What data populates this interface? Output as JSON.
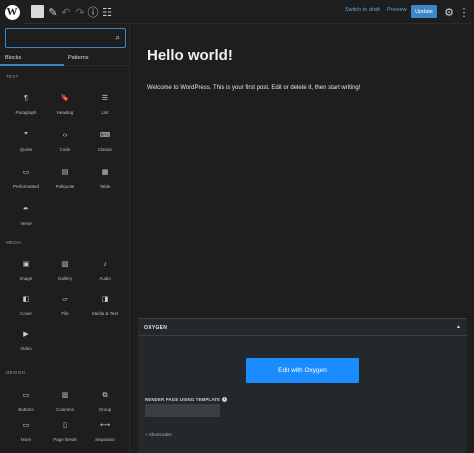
{
  "toolbar": {
    "logo_letter": "W",
    "switch_to_draft": "Switch to draft",
    "preview": "Preview",
    "update": "Update"
  },
  "sidebar": {
    "search_placeholder": "",
    "tabs": [
      "Blocks",
      "Patterns"
    ],
    "categories": {
      "text": "TEXT",
      "media": "MEDIA",
      "design": "DESIGN"
    },
    "text_blocks": [
      {
        "label": "Paragraph",
        "icon": "paragraph-icon",
        "glyph": "¶"
      },
      {
        "label": "Heading",
        "icon": "heading-icon",
        "glyph": "🔖"
      },
      {
        "label": "List",
        "icon": "list-icon",
        "glyph": "☰"
      },
      {
        "label": "Quote",
        "icon": "quote-icon",
        "glyph": "❞"
      },
      {
        "label": "Code",
        "icon": "code-icon",
        "glyph": "‹›"
      },
      {
        "label": "Classic",
        "icon": "keyboard-icon",
        "glyph": "⌨"
      },
      {
        "label": "Preformatted",
        "icon": "preformatted-icon",
        "glyph": "▭"
      },
      {
        "label": "Pullquote",
        "icon": "pullquote-icon",
        "glyph": "▤"
      },
      {
        "label": "Table",
        "icon": "table-icon",
        "glyph": "▦"
      },
      {
        "label": "Verse",
        "icon": "feather-icon",
        "glyph": "✒"
      }
    ],
    "media_blocks": [
      {
        "label": "Image",
        "icon": "image-icon",
        "glyph": "▣"
      },
      {
        "label": "Gallery",
        "icon": "gallery-icon",
        "glyph": "▧"
      },
      {
        "label": "Audio",
        "icon": "music-note-icon",
        "glyph": "♪"
      },
      {
        "label": "Cover",
        "icon": "cover-icon",
        "glyph": "◧"
      },
      {
        "label": "File",
        "icon": "folder-icon",
        "glyph": "▱"
      },
      {
        "label": "Media & Text",
        "icon": "media-text-icon",
        "glyph": "◨"
      },
      {
        "label": "Video",
        "icon": "video-icon",
        "glyph": "▶"
      }
    ],
    "design_blocks": [
      {
        "label": "Buttons",
        "icon": "buttons-icon",
        "glyph": "▭"
      },
      {
        "label": "Columns",
        "icon": "columns-icon",
        "glyph": "▥"
      },
      {
        "label": "Group",
        "icon": "group-icon",
        "glyph": "⧉"
      },
      {
        "label": "More",
        "icon": "more-icon",
        "glyph": "▭"
      },
      {
        "label": "Page Break",
        "icon": "page-break-icon",
        "glyph": "▯"
      },
      {
        "label": "Separator",
        "icon": "separator-icon",
        "glyph": "⟷"
      }
    ]
  },
  "editor": {
    "title": "Hello world!",
    "body": "Welcome to WordPress. This is your first post. Edit or delete it, then start writing!"
  },
  "oxygen": {
    "title": "OXYGEN",
    "edit_button": "Edit with Oxygen",
    "render_label": "RENDER PAGE USING TEMPLATE",
    "info_glyph": "i",
    "template_value": "",
    "shortcodes_link": "+ Shortcodes"
  },
  "colors": {
    "accent": "#3b87c9",
    "oxygen_button": "#1a8cff",
    "background": "#1e1e1e"
  }
}
